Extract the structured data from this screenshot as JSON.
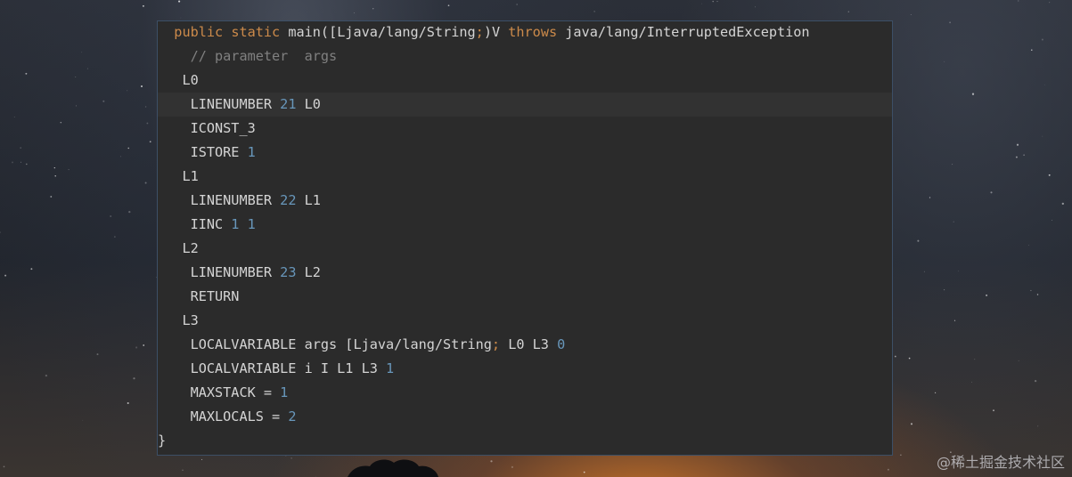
{
  "code": {
    "lines": [
      {
        "indent": "  ",
        "tokens": [
          {
            "t": "kw",
            "v": "public"
          },
          {
            "t": "txt",
            "v": " "
          },
          {
            "t": "kw",
            "v": "static"
          },
          {
            "t": "txt",
            "v": " main([Ljava/lang/String"
          },
          {
            "t": "kw",
            "v": ";"
          },
          {
            "t": "txt",
            "v": ")V "
          },
          {
            "t": "kw",
            "v": "throws"
          },
          {
            "t": "txt",
            "v": " java/lang/InterruptedException"
          }
        ]
      },
      {
        "indent": "    ",
        "tokens": [
          {
            "t": "cmt",
            "v": "// parameter  args"
          }
        ]
      },
      {
        "indent": "   ",
        "tokens": [
          {
            "t": "txt",
            "v": "L0"
          }
        ]
      },
      {
        "indent": "    ",
        "active": true,
        "tokens": [
          {
            "t": "txt",
            "v": "LINENUMBER "
          },
          {
            "t": "num",
            "v": "21"
          },
          {
            "t": "txt",
            "v": " L0"
          }
        ]
      },
      {
        "indent": "    ",
        "tokens": [
          {
            "t": "txt",
            "v": "ICONST_3"
          }
        ]
      },
      {
        "indent": "    ",
        "tokens": [
          {
            "t": "txt",
            "v": "ISTORE "
          },
          {
            "t": "num",
            "v": "1"
          }
        ]
      },
      {
        "indent": "   ",
        "tokens": [
          {
            "t": "txt",
            "v": "L1"
          }
        ]
      },
      {
        "indent": "    ",
        "tokens": [
          {
            "t": "txt",
            "v": "LINENUMBER "
          },
          {
            "t": "num",
            "v": "22"
          },
          {
            "t": "txt",
            "v": " L1"
          }
        ]
      },
      {
        "indent": "    ",
        "tokens": [
          {
            "t": "txt",
            "v": "IINC "
          },
          {
            "t": "num",
            "v": "1"
          },
          {
            "t": "txt",
            "v": " "
          },
          {
            "t": "num",
            "v": "1"
          }
        ]
      },
      {
        "indent": "   ",
        "tokens": [
          {
            "t": "txt",
            "v": "L2"
          }
        ]
      },
      {
        "indent": "    ",
        "tokens": [
          {
            "t": "txt",
            "v": "LINENUMBER "
          },
          {
            "t": "num",
            "v": "23"
          },
          {
            "t": "txt",
            "v": " L2"
          }
        ]
      },
      {
        "indent": "    ",
        "tokens": [
          {
            "t": "txt",
            "v": "RETURN"
          }
        ]
      },
      {
        "indent": "   ",
        "tokens": [
          {
            "t": "txt",
            "v": "L3"
          }
        ]
      },
      {
        "indent": "    ",
        "tokens": [
          {
            "t": "txt",
            "v": "LOCALVARIABLE args [Ljava/lang/String"
          },
          {
            "t": "kw",
            "v": ";"
          },
          {
            "t": "txt",
            "v": " L0 L3 "
          },
          {
            "t": "num",
            "v": "0"
          }
        ]
      },
      {
        "indent": "    ",
        "tokens": [
          {
            "t": "txt",
            "v": "LOCALVARIABLE i I L1 L3 "
          },
          {
            "t": "num",
            "v": "1"
          }
        ]
      },
      {
        "indent": "    ",
        "tokens": [
          {
            "t": "txt",
            "v": "MAXSTACK = "
          },
          {
            "t": "num",
            "v": "1"
          }
        ]
      },
      {
        "indent": "    ",
        "tokens": [
          {
            "t": "txt",
            "v": "MAXLOCALS = "
          },
          {
            "t": "num",
            "v": "2"
          }
        ]
      },
      {
        "indent": "",
        "tokens": [
          {
            "t": "txt",
            "v": "}"
          }
        ]
      }
    ]
  },
  "watermark": "@稀土掘金技术社区",
  "colors": {
    "keyword": "#cc8a4a",
    "number": "#6897bb",
    "comment": "#808080",
    "text": "#d4d4d4",
    "editor_bg": "#2b2b2b"
  }
}
